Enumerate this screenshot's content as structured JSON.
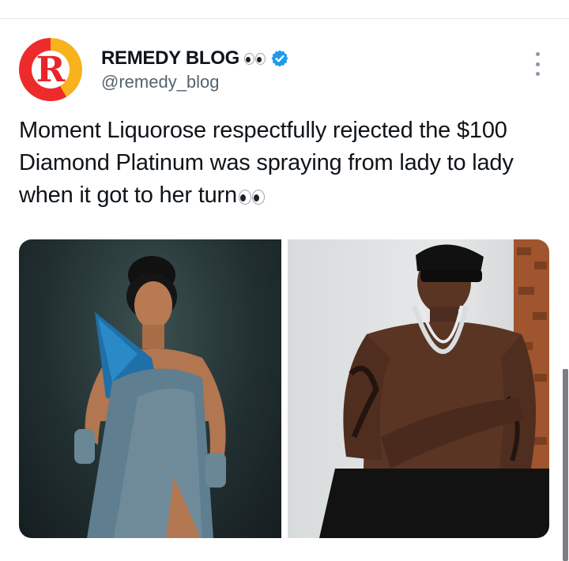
{
  "tweet": {
    "author": {
      "display_name": "REMEDY BLOG",
      "handle": "@remedy_blog",
      "avatar_letter": "R",
      "avatar_colors": [
        "#f7b21d",
        "#ee2b2b"
      ],
      "name_emoji": "eyes-icon",
      "verified": true,
      "verified_color": "#1d9bf0"
    },
    "text": "Moment Liquorose respectfully rejected the $100 Diamond Platinum was spraying from lady to lady when it got to her turn",
    "text_trailing_emoji": "eyes-icon",
    "media": [
      {
        "name": "woman-in-sparkly-blue-gown-photo"
      },
      {
        "name": "tattooed-man-with-chains-photo"
      }
    ]
  },
  "colors": {
    "text": "#0f1419",
    "secondary": "#536471",
    "divider": "#e1e8ed"
  }
}
